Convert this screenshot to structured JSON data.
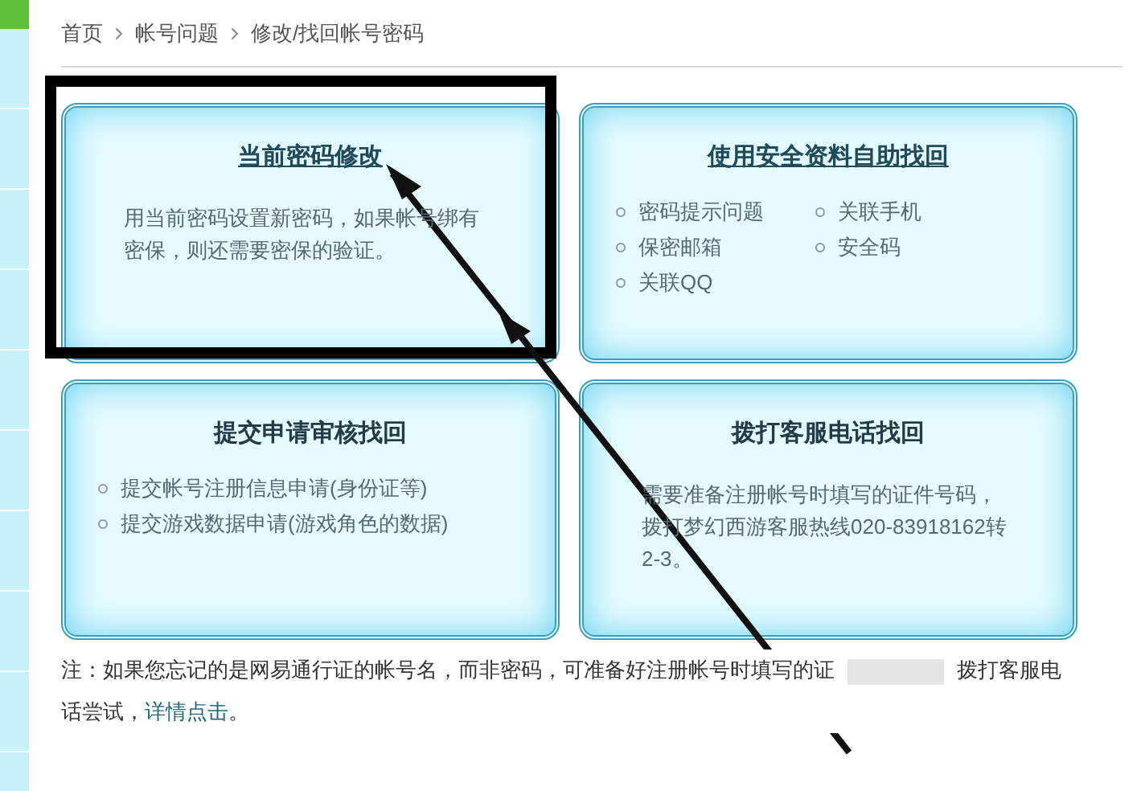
{
  "breadcrumb": [
    "首页",
    "帐号问题",
    "修改/找回帐号密码"
  ],
  "cards": [
    {
      "kind": "paragraph",
      "title": "当前密码修改",
      "title_link": true,
      "text": "用当前密码设置新密码，如果帐号绑有密保，则还需要密保的验证。"
    },
    {
      "kind": "list",
      "title": "使用安全资料自助找回",
      "title_link": true,
      "columns": [
        [
          "密码提示问题",
          "保密邮箱",
          "关联QQ"
        ],
        [
          "关联手机",
          "安全码"
        ]
      ]
    },
    {
      "kind": "list",
      "title": "提交申请审核找回",
      "title_link": false,
      "columns": [
        [
          "提交帐号注册信息申请(身份证等)",
          "提交游戏数据申请(游戏角色的数据)"
        ]
      ]
    },
    {
      "kind": "paragraph",
      "title": "拨打客服电话找回",
      "title_link": false,
      "text": "需要准备注册帐号时填写的证件号码，拨打梦幻西游客服热线020-83918162转2-3。"
    }
  ],
  "note": {
    "before": "注：如果您忘记的是网易通行证的帐号名，而非密码，可准备好注册帐号时填写的证",
    "after": "拨打客服电话尝试，",
    "link": "详情点击",
    "end": "。"
  }
}
